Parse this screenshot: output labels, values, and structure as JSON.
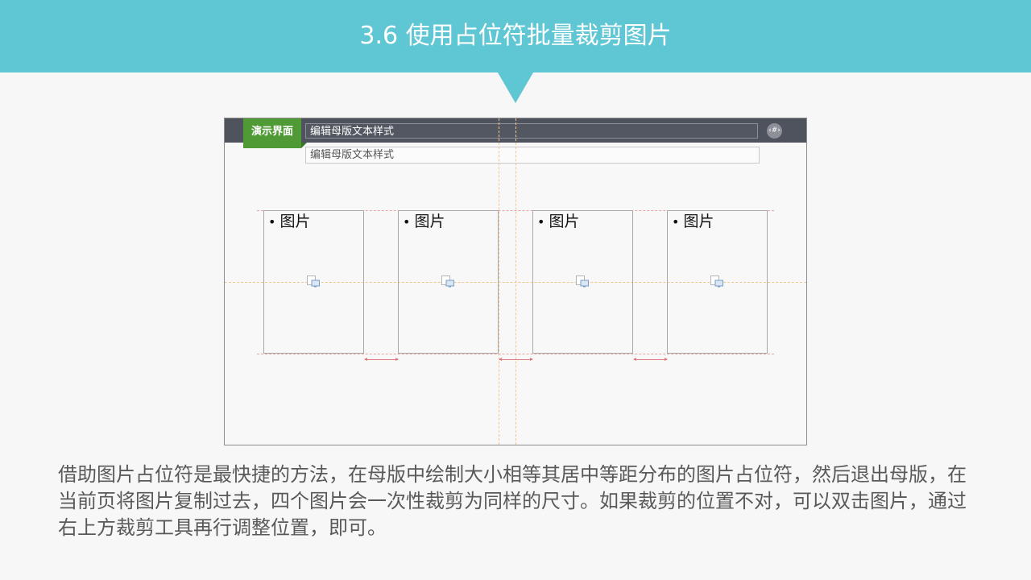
{
  "header": {
    "title": "3.6 使用占位符批量裁剪图片",
    "color": "#5fc6d3"
  },
  "screenshot": {
    "tag_label": "演示界面",
    "title_box_text": "编辑母版文本样式",
    "subtitle_box_text": "编辑母版文本样式",
    "page_number_badge": "‹#›",
    "placeholders": [
      {
        "label": "图片",
        "icon": "picture-placeholder-icon"
      },
      {
        "label": "图片",
        "icon": "picture-placeholder-icon"
      },
      {
        "label": "图片",
        "icon": "picture-placeholder-icon"
      },
      {
        "label": "图片",
        "icon": "picture-placeholder-icon"
      }
    ]
  },
  "body": {
    "text": "借助图片占位符是最快捷的方法，在母版中绘制大小相等其居中等距分布的图片占位符，然后退出母版，在当前页将图片复制过去，四个图片会一次性裁剪为同样的尺寸。如果裁剪的位置不对，可以双击图片，通过右上方裁剪工具再行调整位置，即可。"
  }
}
